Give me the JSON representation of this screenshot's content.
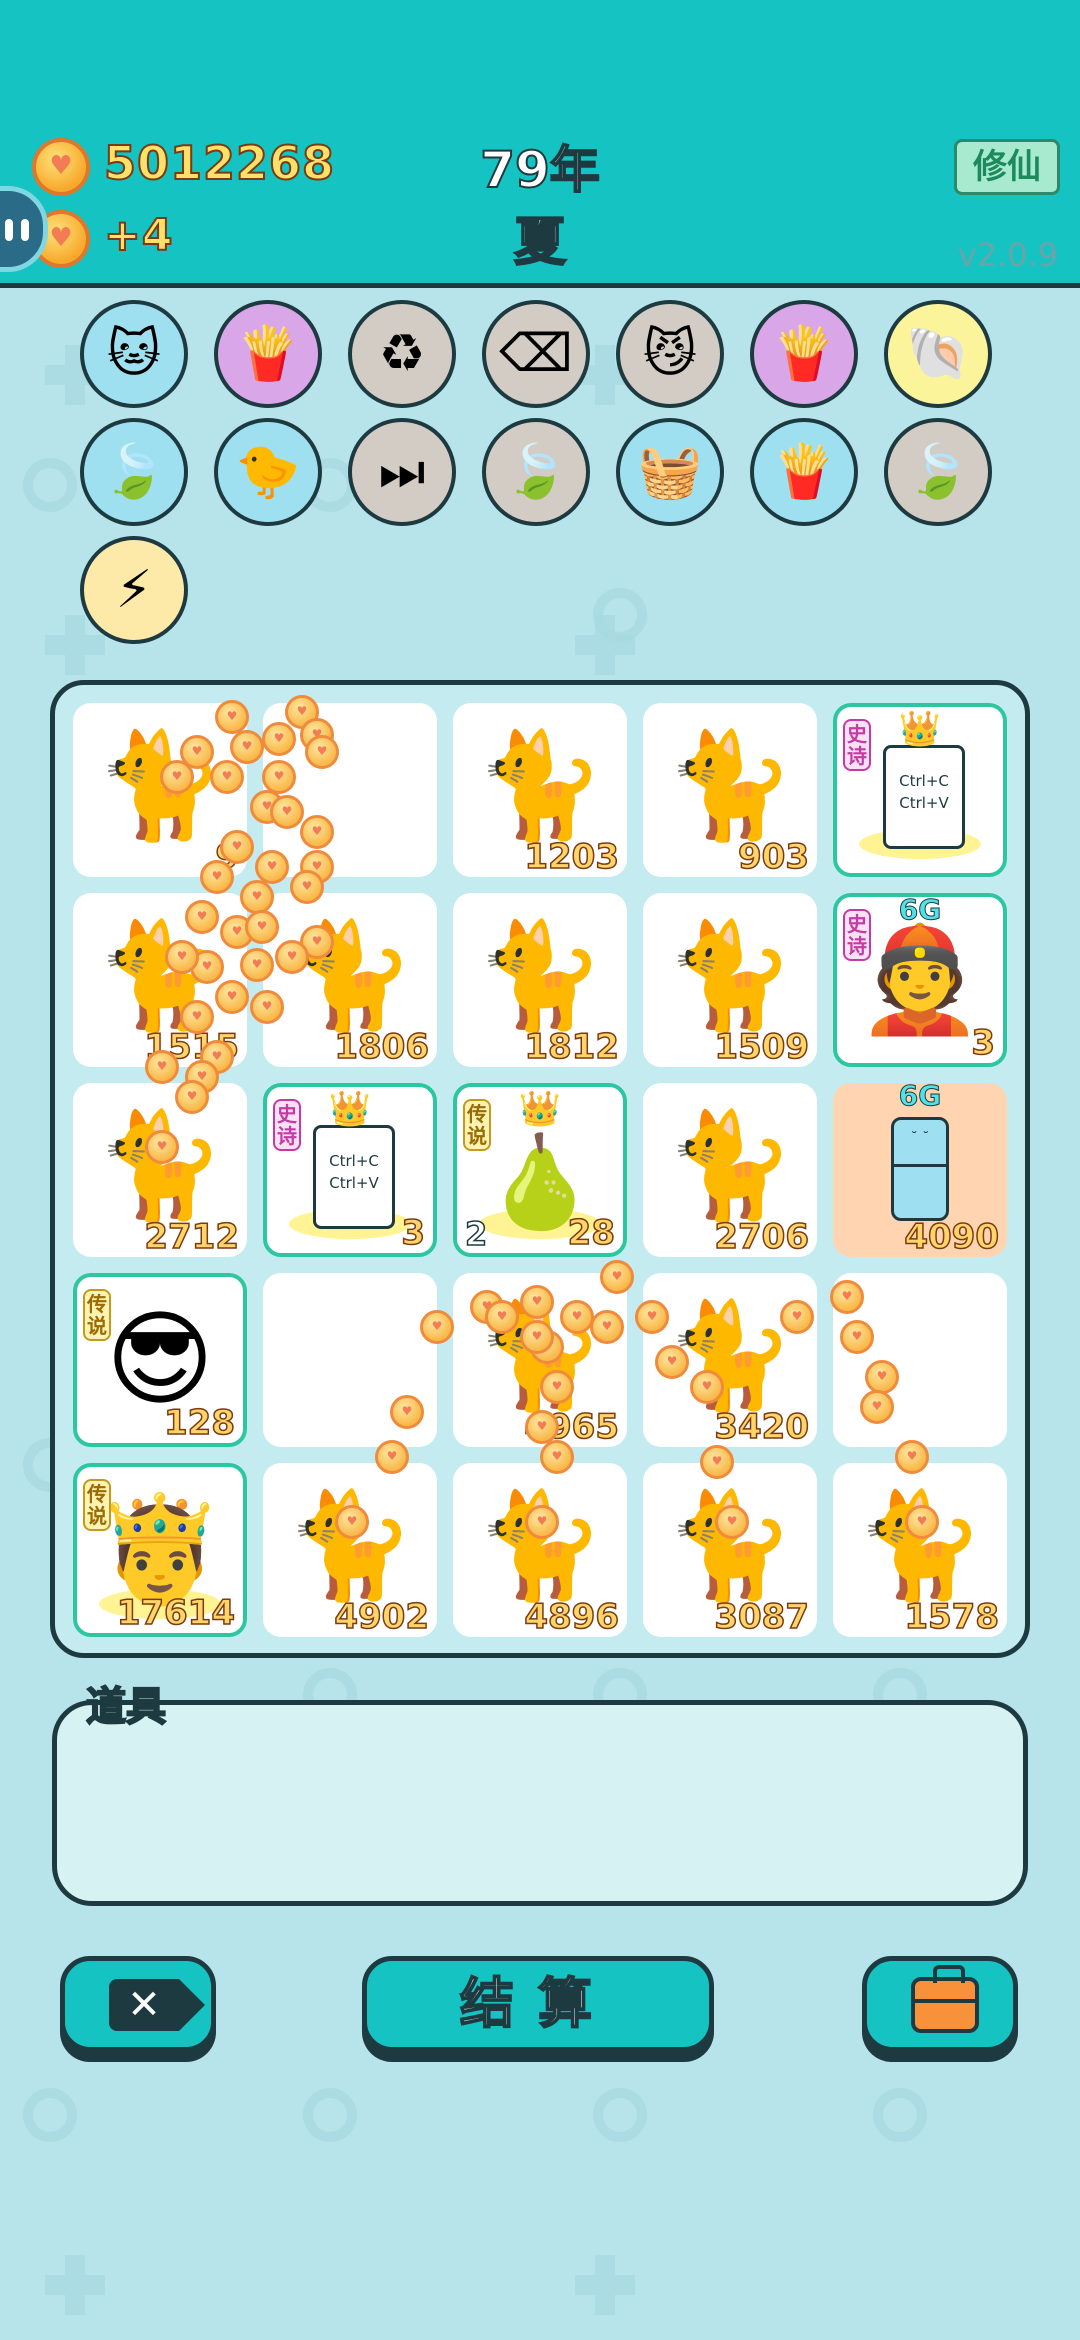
{
  "header": {
    "coins": "5012268",
    "coin_rate": "+4",
    "year": "79年",
    "season": "夏",
    "xiuxian_label": "修仙",
    "version": "v2.0.9"
  },
  "items": [
    {
      "icon": "cat-glasses-icon",
      "glyph": "🐱",
      "bg": "#9fe0f0",
      "coin": true
    },
    {
      "icon": "fries-icon",
      "glyph": "🍟",
      "bg": "#d9a6e8",
      "coin": true
    },
    {
      "icon": "recycle-icon",
      "glyph": "♻",
      "bg": "#d2ccc4",
      "coin": false
    },
    {
      "icon": "delete-tag-icon",
      "glyph": "⌫",
      "bg": "#d2ccc4",
      "coin": true
    },
    {
      "icon": "cat-eyes-icon",
      "glyph": "😼",
      "bg": "#d2ccc4",
      "coin": true
    },
    {
      "icon": "fries-icon",
      "glyph": "🍟",
      "bg": "#d9a6e8",
      "coin": true
    },
    {
      "icon": "shell-icon",
      "glyph": "🐚",
      "bg": "#fbf49a",
      "coin": false
    },
    {
      "icon": "leaf-icon",
      "glyph": "🍃",
      "bg": "#9fe0f0",
      "coin": true
    },
    {
      "icon": "chick-icon",
      "glyph": "🐤",
      "bg": "#9fe0f0",
      "coin": false
    },
    {
      "icon": "skip-icon",
      "glyph": "⏭",
      "bg": "#d2ccc4",
      "coin": true
    },
    {
      "icon": "leaf-icon",
      "glyph": "🍃",
      "bg": "#d2ccc4",
      "coin": true
    },
    {
      "icon": "fruit-basket-icon",
      "glyph": "🧺",
      "bg": "#9fe0f0",
      "coin": true
    },
    {
      "icon": "fries-icon",
      "glyph": "🍟",
      "bg": "#9fe0f0",
      "coin": true
    },
    {
      "icon": "leaf-icon",
      "glyph": "🍃",
      "bg": "#d2ccc4",
      "coin": true
    },
    {
      "icon": "lightning-icon",
      "glyph": "⚡",
      "bg": "#fde9a8",
      "coin": false
    }
  ],
  "board": [
    {
      "kind": "cat",
      "num": "9"
    },
    {
      "kind": "empty",
      "num": ""
    },
    {
      "kind": "cat",
      "num": "1203"
    },
    {
      "kind": "cat",
      "num": "903"
    },
    {
      "kind": "copy-paste",
      "tag": "史诗",
      "tag_type": "epic",
      "ctrl1": "Ctrl+C",
      "ctrl2": "Ctrl+V",
      "num": ""
    },
    {
      "kind": "cat",
      "num": "1515"
    },
    {
      "kind": "cat",
      "num": "1806"
    },
    {
      "kind": "cat",
      "num": "1812"
    },
    {
      "kind": "cat",
      "num": "1509"
    },
    {
      "kind": "red-hat",
      "tag": "史诗",
      "tag_type": "epic",
      "top": "6G",
      "num": "3"
    },
    {
      "kind": "cat",
      "num": "2712"
    },
    {
      "kind": "copy-paste",
      "tag": "史诗",
      "tag_type": "epic",
      "ctrl1": "Ctrl+C",
      "ctrl2": "Ctrl+V",
      "num": "3"
    },
    {
      "kind": "pear",
      "tag": "传说",
      "tag_type": "legend",
      "left": "2",
      "num": "28"
    },
    {
      "kind": "cat",
      "num": "2706"
    },
    {
      "kind": "fridge",
      "top": "6G",
      "num": "4090"
    },
    {
      "kind": "sunglasses",
      "tag": "传说",
      "tag_type": "legend",
      "num": "128"
    },
    {
      "kind": "empty",
      "num": ""
    },
    {
      "kind": "cat",
      "num": "4965"
    },
    {
      "kind": "cat",
      "num": "3420"
    },
    {
      "kind": "empty",
      "num": ""
    },
    {
      "kind": "king",
      "tag": "传说",
      "tag_type": "legend",
      "num": "17614"
    },
    {
      "kind": "cat",
      "num": "4902"
    },
    {
      "kind": "cat",
      "num": "4896"
    },
    {
      "kind": "cat",
      "num": "3087"
    },
    {
      "kind": "cat",
      "num": "1578"
    }
  ],
  "props": {
    "label": "道具"
  },
  "buttons": {
    "delete_icon": "✕",
    "settle_label": "结算",
    "bag_icon": "briefcase-icon"
  }
}
